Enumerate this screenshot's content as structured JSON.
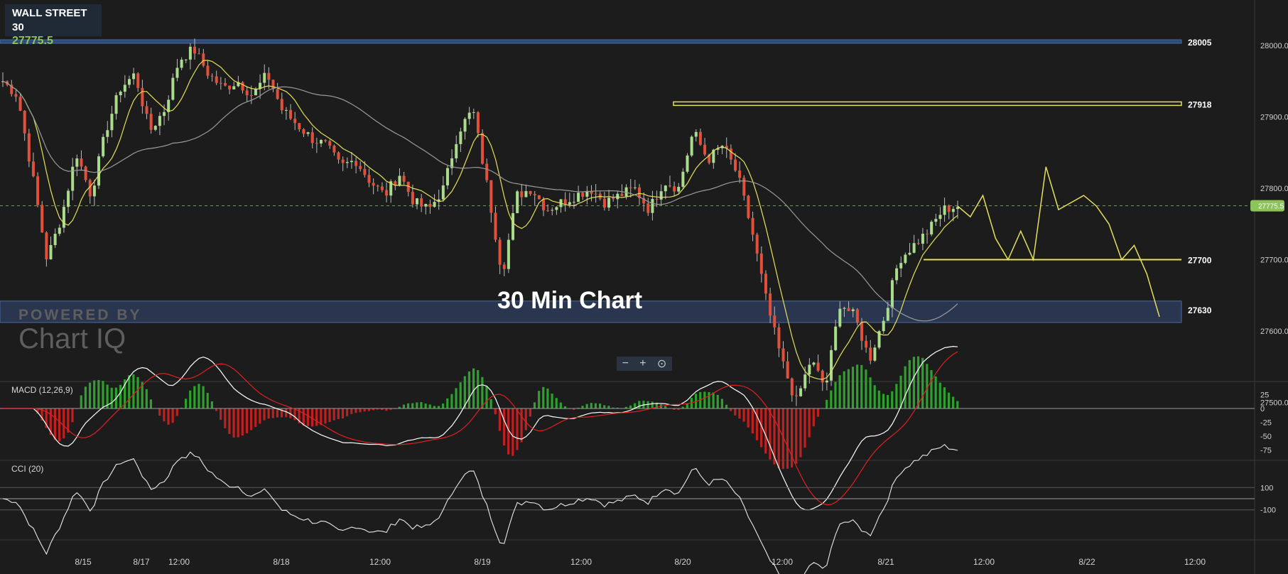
{
  "instrument": {
    "name": "WALL STREET 30",
    "price": "27775.5"
  },
  "caption": "30 Min Chart",
  "watermark": {
    "top": "POWERED BY",
    "brand": "Chart IQ"
  },
  "zoom_controls": {
    "zoom_out": "−",
    "zoom_in": "+",
    "reset": "⊙"
  },
  "colors": {
    "background": "#1c1c1c",
    "up_candle": "#a9dc8c",
    "down_candle": "#e2503a",
    "fast_ma": "#e6e05a",
    "slow_ma": "#9a9a9a",
    "support_zone": "#2a3550",
    "resistance_band": "#2e4a78",
    "projection": "#e6e05a",
    "price_tag": "#8cc45a",
    "macd_line": "#ffffff",
    "signal_line": "#e02020"
  },
  "chart_data": [
    {
      "type": "candlestick",
      "title": "WALL STREET 30",
      "last_price": 27775.5,
      "ylim": [
        27420,
        28060
      ],
      "y_ticks": [
        28000.0,
        27900.0,
        27800.0,
        27700.0,
        27600.0,
        27500.0
      ],
      "x_tick_labels": [
        "8/15",
        "8/17",
        "12:00",
        "8/18",
        "12:00",
        "8/19",
        "12:00",
        "8/20",
        "12:00",
        "8/21",
        "12:00",
        "8/22",
        "12:00"
      ],
      "levels": [
        {
          "label": "28005",
          "value": 28005,
          "kind": "band"
        },
        {
          "label": "27918",
          "value": 27918,
          "kind": "band"
        },
        {
          "label": "27700",
          "value": 27700,
          "kind": "line"
        },
        {
          "label": "27630",
          "value": 27630,
          "kind": "zone",
          "range": [
            27612,
            27642
          ]
        }
      ],
      "close_path": [
        27950,
        27930,
        27820,
        27700,
        27760,
        27850,
        27790,
        27880,
        27940,
        27960,
        27880,
        27910,
        27980,
        27995,
        27960,
        27940,
        27950,
        27930,
        27960,
        27910,
        27890,
        27870,
        27860,
        27830,
        27840,
        27810,
        27790,
        27820,
        27780,
        27770,
        27800,
        27880,
        27910,
        27800,
        27680,
        27790,
        27800,
        27770,
        27780,
        27790,
        27800,
        27780,
        27790,
        27800,
        27770,
        27810,
        27800,
        27880,
        27840,
        27860,
        27820,
        27740,
        27640,
        27560,
        27500,
        27560,
        27520,
        27640,
        27620,
        27560,
        27620,
        27700,
        27720,
        27740,
        27770,
        27775
      ],
      "projection_path": [
        27775,
        27760,
        27790,
        27730,
        27700,
        27740,
        27700,
        27830,
        27770,
        27780,
        27790,
        27775,
        27750,
        27700,
        27720,
        27680,
        27620
      ]
    },
    {
      "type": "line",
      "title": "MACD (12,26,9)",
      "y_ticks": [
        25,
        0,
        -25,
        -50,
        -75
      ],
      "ylim": [
        -90,
        40
      ]
    },
    {
      "type": "line",
      "title": "CCI (20)",
      "y_ticks": [
        100,
        -100
      ],
      "ylim": [
        -300,
        280
      ]
    }
  ]
}
